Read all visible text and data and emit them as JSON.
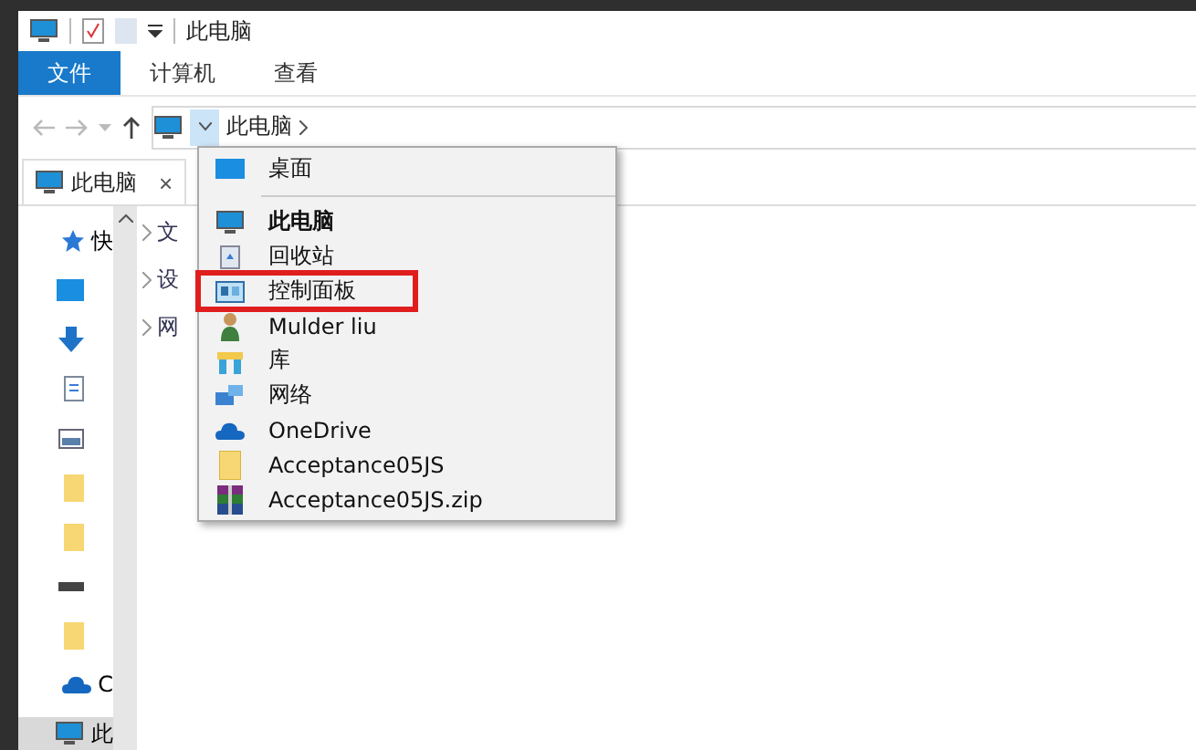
{
  "window": {
    "title": "此电脑"
  },
  "ribbon_tabs": [
    {
      "label": "文件",
      "selected": true
    },
    {
      "label": "计算机",
      "selected": false
    },
    {
      "label": "查看",
      "selected": false
    }
  ],
  "address_bar": {
    "location": "此电脑",
    "dropdown_open": true
  },
  "tab": {
    "label": "此电脑",
    "close": "×"
  },
  "nav_pane": {
    "items": [
      {
        "label": "快",
        "selected": false
      },
      {
        "label": "C",
        "selected": false
      },
      {
        "label": "此",
        "selected": true
      }
    ]
  },
  "tree_items": [
    "文",
    "设",
    "网"
  ],
  "dropdown": {
    "items": [
      {
        "label": "桌面",
        "current": false,
        "highlighted": false,
        "separator_after": true
      },
      {
        "label": "此电脑",
        "current": true,
        "highlighted": false,
        "separator_after": false
      },
      {
        "label": "回收站",
        "current": false,
        "highlighted": false,
        "separator_after": false
      },
      {
        "label": "控制面板",
        "current": false,
        "highlighted": true,
        "separator_after": false
      },
      {
        "label": "Mulder liu",
        "current": false,
        "highlighted": false,
        "separator_after": false
      },
      {
        "label": "库",
        "current": false,
        "highlighted": false,
        "separator_after": false
      },
      {
        "label": "网络",
        "current": false,
        "highlighted": false,
        "separator_after": false
      },
      {
        "label": "OneDrive",
        "current": false,
        "highlighted": false,
        "separator_after": false
      },
      {
        "label": "Acceptance05JS",
        "current": false,
        "highlighted": false,
        "separator_after": false
      },
      {
        "label": "Acceptance05JS.zip",
        "current": false,
        "highlighted": false,
        "separator_after": false
      }
    ]
  }
}
